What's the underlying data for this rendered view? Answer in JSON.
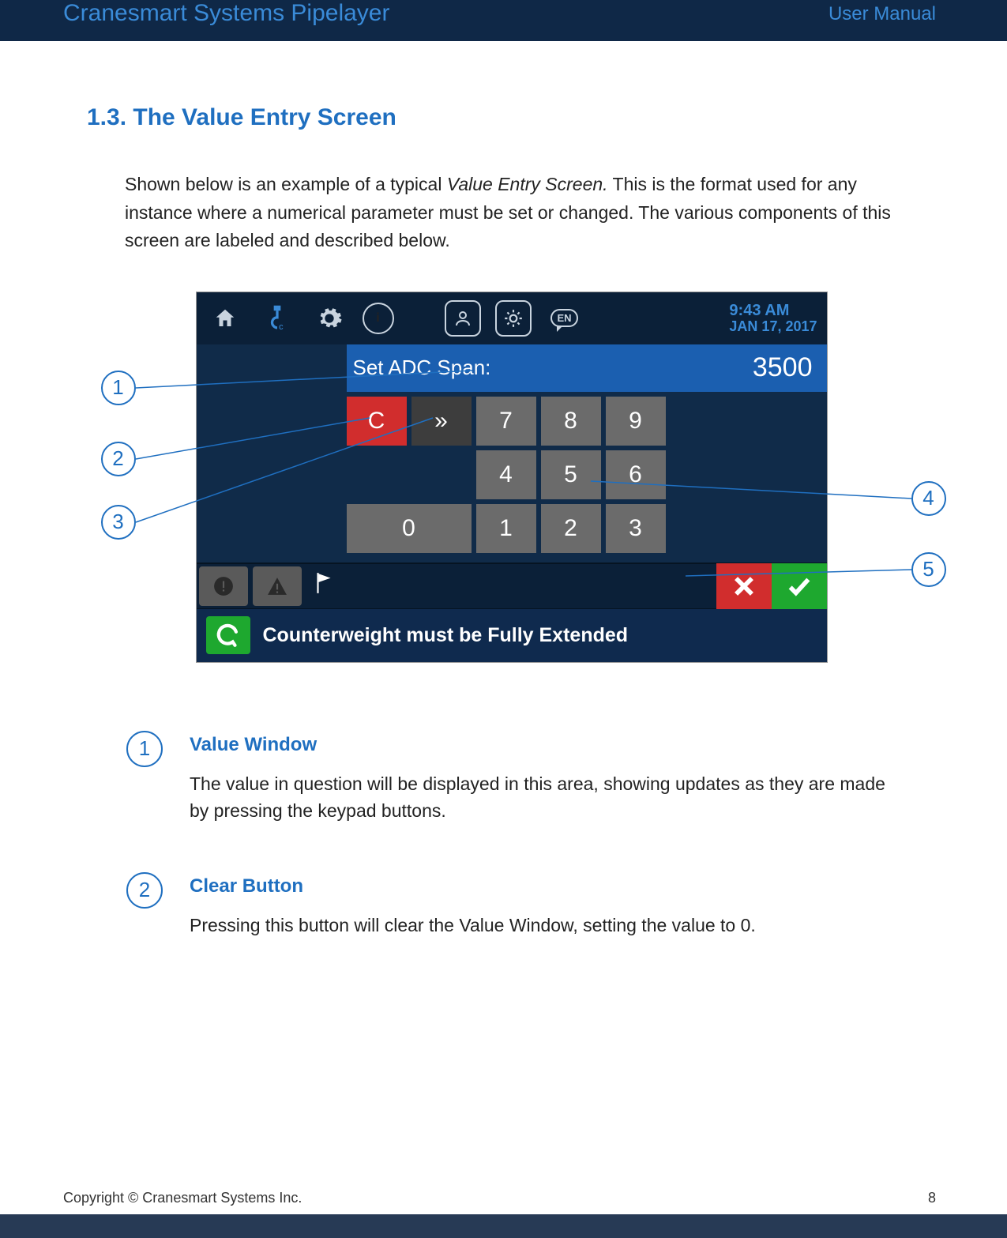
{
  "header": {
    "left": "Cranesmart Systems Pipelayer",
    "right": "User Manual"
  },
  "section": {
    "number": "1.3.",
    "title": "The Value Entry Screen"
  },
  "intro": {
    "pre": "Shown below is an example of a typical ",
    "em": "Value Entry Screen.",
    "post": "  This is the format used for any instance where a numerical parameter must be set or changed.  The various components of this screen are labeled and described below."
  },
  "screen": {
    "clock_time": "9:43 AM",
    "clock_date": "JAN 17, 2017",
    "lang": "EN",
    "value_label": "Set ADC Span:",
    "value": "3500",
    "keys": {
      "clear": "C",
      "back": "»",
      "k7": "7",
      "k8": "8",
      "k9": "9",
      "k4": "4",
      "k5": "5",
      "k6": "6",
      "k0": "0",
      "k1": "1",
      "k2": "2",
      "k3": "3"
    },
    "cancel": "✕",
    "ok": "✓",
    "message_icon": "G",
    "message": "Counterweight must be Fully Extended"
  },
  "callouts": {
    "c1": "1",
    "c2": "2",
    "c3": "3",
    "c4": "4",
    "c5": "5"
  },
  "descriptions": [
    {
      "num": "1",
      "title": "Value Window",
      "body": "The value in question will be displayed in this area, showing updates as they are made by pressing the keypad buttons."
    },
    {
      "num": "2",
      "title": "Clear Button",
      "body": "Pressing this button will clear the Value Window, setting the value to 0."
    }
  ],
  "footer": {
    "copyright": "Copyright © Cranesmart Systems Inc.",
    "page": "8"
  }
}
